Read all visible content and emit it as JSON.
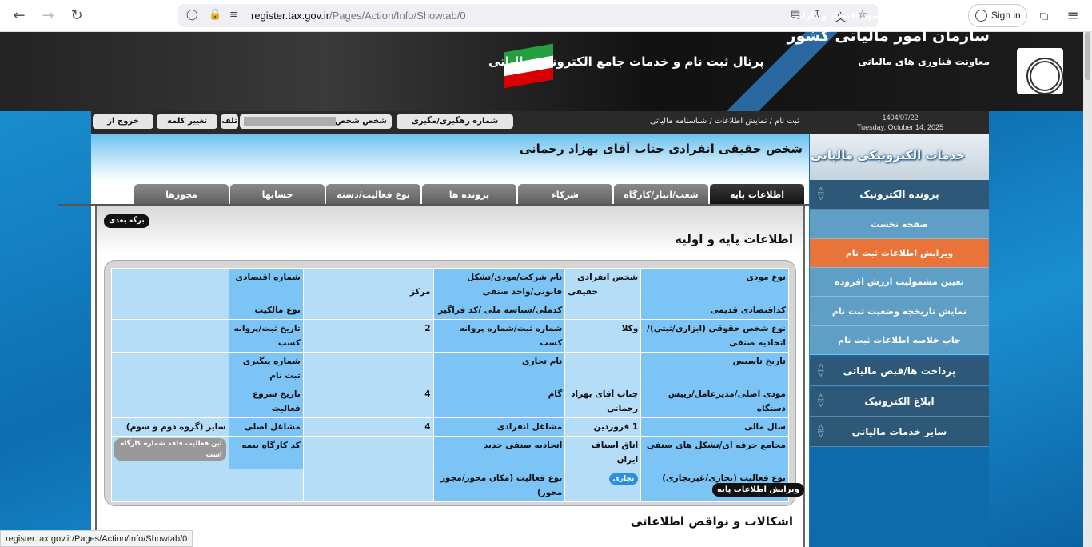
{
  "browser": {
    "url_domain": "register.tax.gov.ir",
    "url_path": "/Pages/Action/Info/Showtab/0",
    "signin_label": "Sign in",
    "status_url": "register.tax.gov.ir/Pages/Action/Info/Showtab/0"
  },
  "header": {
    "ministry": "وزارت امور اقتصاد و دارایی",
    "org": "سازمان امور مالیاتی کشور",
    "deputy": "معاونت فناوری های مالیاتی",
    "portal": "پرتال ثبت نام و خدمات جامع الکترونیک مالیاتی"
  },
  "infobar": {
    "date_fa": "1404/07/22",
    "date_en": "Tuesday, October 14, 2025",
    "breadcrumb": "ثبت نام / نمایش اطلاعات / شناسنامه مالیاتی",
    "tracking_label": "شماره رهگیری/مگیری",
    "person_label": "شخص شخص",
    "tel_label": "تلف",
    "change_password": "تغییر کلمه عبور",
    "logout": "خروج از سیستم"
  },
  "sidebar": {
    "banner": "خدمات الکترونیکی مالیاتی",
    "sections": [
      {
        "label": "پرونده الکترونیک"
      },
      {
        "label": "پرداخت ها/قبض مالیاتی"
      },
      {
        "label": "ابلاغ الکترونیک"
      },
      {
        "label": "سایر خدمات مالیاتی"
      }
    ],
    "items": [
      {
        "label": "صفحه نخست"
      },
      {
        "label": "ویرایش اطلاعات ثبت نام"
      },
      {
        "label": "تعیین مشمولیت ارزش افزوده"
      },
      {
        "label": "نمایش تاریخچه وضعیت ثبت نام"
      },
      {
        "label": "چاپ خلاصه اطلاعات ثبت نام"
      }
    ]
  },
  "main": {
    "title": "شخص حقیقی انفرادی جناب آقای بهزاد رحمانی",
    "tabs": [
      {
        "label": "اطلاعات پایه"
      },
      {
        "label": "شعب/انبار/کارگاه"
      },
      {
        "label": "شرکاء"
      },
      {
        "label": "پرونده ها"
      },
      {
        "label": "نوع فعالیت/دسته بندی"
      },
      {
        "label": "حسابها"
      },
      {
        "label": "مجوزها"
      }
    ],
    "next_page": "برگه بعدی",
    "section_title": "اطلاعات پایه و اولیه",
    "edit_button": "ویرایش اطلاعات پایه",
    "issues_title": "اشکالات و نواقص اطلاعاتی"
  },
  "grid": {
    "rows": [
      [
        "نوع مودی",
        "شخص انفرادی",
        "حقیقی",
        "نام شرکت/مودی/تشکل قانونی/واحد صنفی",
        "مرکز",
        "شماره اقتصادی",
        ""
      ],
      [
        "کداقتصادی قدیمی",
        "",
        "",
        "کدملی/شناسه ملی /کد فراگیر",
        "",
        "نوع مالکیت",
        ""
      ],
      [
        "نوع شخص حقوقی (ابزاری/ثبتی)/اتحادیه صنفی",
        "وکلا",
        "",
        "شماره ثبت/شماره پروانه کسب",
        "2",
        "تاریخ ثبت/پروانه کسب",
        ""
      ],
      [
        "تاریخ تاسیس",
        "",
        "",
        "نام تجاری",
        "",
        "شماره پیگیری ثبت نام",
        ""
      ],
      [
        "مودی اصلی/مدیرعامل/رییس دستگاه",
        "جناب آقای بهزاد رحمانی",
        "",
        "گام",
        "4",
        "تاریخ شروع فعالیت",
        ""
      ],
      [
        "سال مالی",
        "1 فروردین",
        "",
        "مشاغل انفرادی",
        "4",
        "مشاغل اصلی",
        "سایر (گروه دوم و سوم)"
      ],
      [
        "مجامع حرفه ای/تشکل های صنفی",
        "اتاق اصناف ایران",
        "",
        "اتحادیه صنفی جدید",
        "",
        "کد کارگاه بیمه",
        "این فعالیت فاقد شماره کارگاه است"
      ],
      [
        "نوع فعالیت (تجاری/غیرتجاری)",
        "تجاری",
        "",
        "نوع فعالیت (مکان محور/مجوز محور)",
        "",
        "",
        ""
      ]
    ]
  }
}
